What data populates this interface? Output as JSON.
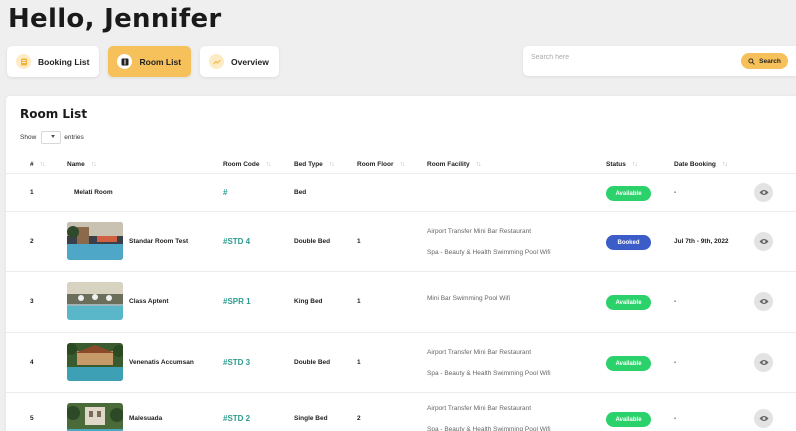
{
  "greeting": "Hello, Jennifer",
  "tabs": [
    {
      "label": "Booking List",
      "icon": "booking-icon"
    },
    {
      "label": "Room List",
      "icon": "room-icon"
    },
    {
      "label": "Overview",
      "icon": "chart-trend-icon"
    }
  ],
  "search": {
    "placeholder": "Search here",
    "button_label": "Search"
  },
  "room_list": {
    "title": "Room List",
    "show_label": "Show",
    "entries_label": "entries",
    "columns": [
      "#",
      "Name",
      "Room Code",
      "Bed Type",
      "Room Floor",
      "Room Facility",
      "Status",
      "Date Booking"
    ],
    "rows": [
      {
        "num": "1",
        "name": "Melati Room",
        "code": "#",
        "bed": "Bed",
        "floor": "",
        "facility": [
          "",
          ""
        ],
        "status": "Available",
        "date": "-"
      },
      {
        "num": "2",
        "name": "Standar Room Test",
        "code": "#STD 4",
        "bed": "Double Bed",
        "floor": "1",
        "facility": [
          "Airport Transfer Mini Bar Restaurant",
          "Spa - Beauty & Health Swimming Pool Wifi"
        ],
        "status": "Booked",
        "date": "Jul 7th - 9th, 2022"
      },
      {
        "num": "3",
        "name": "Class Aptent",
        "code": "#SPR 1",
        "bed": "King Bed",
        "floor": "1",
        "facility": [
          "Mini Bar Swimming Pool Wifi",
          ""
        ],
        "status": "Available",
        "date": "-"
      },
      {
        "num": "4",
        "name": "Venenatis Accumsan",
        "code": "#STD 3",
        "bed": "Double Bed",
        "floor": "1",
        "facility": [
          "Airport Transfer Mini Bar Restaurant",
          "Spa - Beauty & Health Swimming Pool Wifi"
        ],
        "status": "Available",
        "date": "-"
      },
      {
        "num": "5",
        "name": "Malesuada",
        "code": "#STD 2",
        "bed": "Single Bed",
        "floor": "2",
        "facility": [
          "Airport Transfer Mini Bar Restaurant",
          "Spa - Beauty & Health Swimming Pool Wifi"
        ],
        "status": "Available",
        "date": "-"
      }
    ]
  },
  "colors": {
    "accent": "#f6c15a",
    "code": "#2e9c8f",
    "available": "#2bd16a",
    "booked": "#3c5cc7"
  }
}
